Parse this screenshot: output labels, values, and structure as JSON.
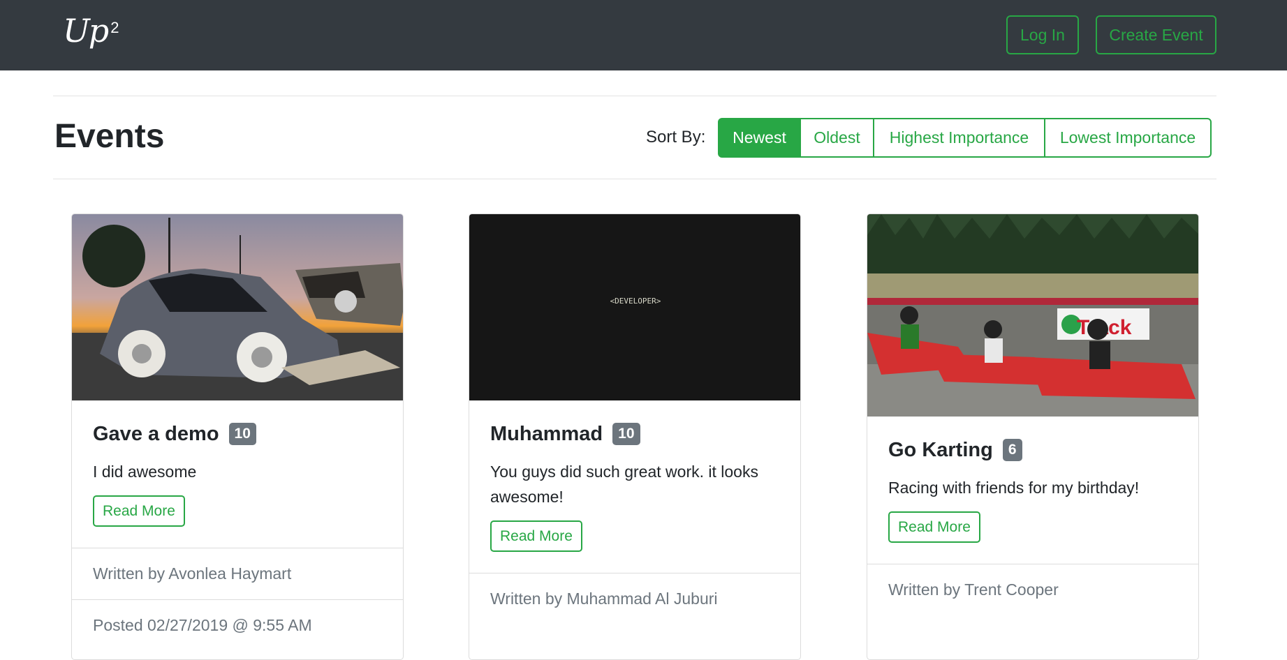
{
  "navbar": {
    "logo_text": "Up",
    "logo_sup": "2",
    "login_label": "Log In",
    "create_label": "Create Event",
    "bg_color": "#343a40",
    "accent_color": "#28a745"
  },
  "page": {
    "title": "Events",
    "sort_label": "Sort By:",
    "sort_options": [
      "Newest",
      "Oldest",
      "Highest Importance",
      "Lowest Importance"
    ],
    "sort_selected": "Newest"
  },
  "cards": [
    {
      "title": "Gave a demo",
      "badge": "10",
      "text": "I did awesome",
      "button": "Read More",
      "author": "Written by Avonlea Haymart",
      "posted": "Posted 02/27/2019 @ 9:55 AM"
    },
    {
      "title": "Muhammad",
      "badge": "10",
      "image_text": "<DEVELOPER>",
      "text": "You guys did such great work. it looks awesome!",
      "button": "Read More",
      "author": "Written by Muhammad Al Juburi"
    },
    {
      "title": "Go Karting",
      "badge": "6",
      "image_text": "Track",
      "text": "Racing with friends for my birthday!",
      "button": "Read More",
      "author": "Written by Trent Cooper"
    }
  ]
}
